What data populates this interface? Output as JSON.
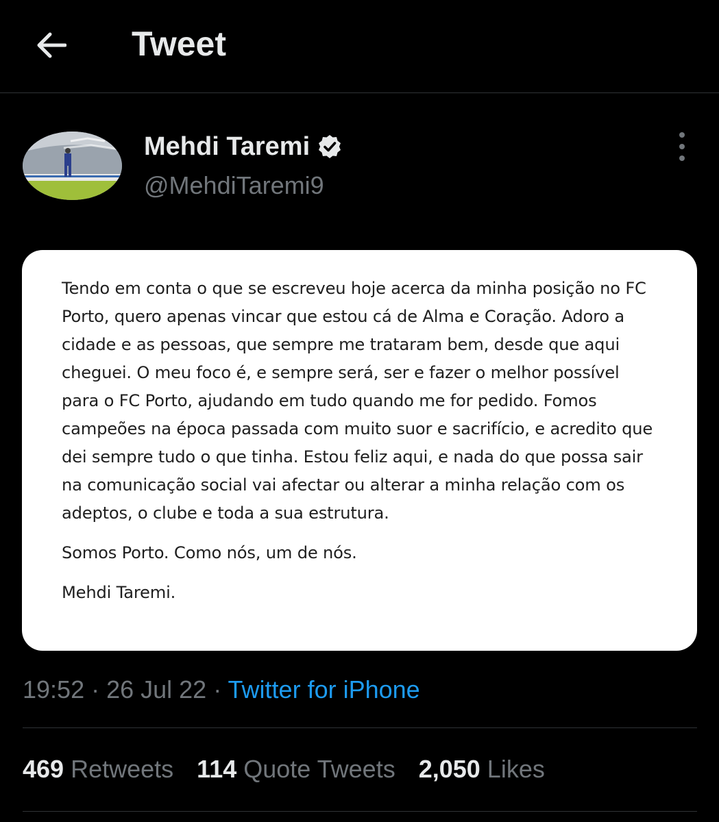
{
  "header": {
    "title": "Tweet",
    "back_icon": "arrow-left-icon"
  },
  "author": {
    "display_name": "Mehdi Taremi",
    "handle": "@MehdiTaremi9",
    "verified": true
  },
  "statement": {
    "paragraph1": "Tendo em conta o que se escreveu hoje acerca da minha posição no FC Porto, quero apenas vincar que estou cá de Alma e Coração. Adoro a cidade e as pessoas, que sempre me trataram bem, desde que aqui cheguei. O meu foco é, e sempre será, ser e fazer o melhor possível para o FC Porto, ajudando em tudo quando me for pedido. Fomos campeões na época passada com muito suor e sacrifício, e acredito que dei sempre tudo o que tinha. Estou feliz aqui, e nada do que possa sair na comunicação social vai afectar ou alterar a minha relação com os adeptos, o clube  e toda a sua estrutura.",
    "paragraph2": "Somos Porto. Como nós, um de nós.",
    "signature": "Mehdi Taremi."
  },
  "meta": {
    "time": "19:52",
    "separator1": " · ",
    "date": "26 Jul 22",
    "separator2": " · ",
    "source": "Twitter for iPhone"
  },
  "stats": {
    "retweets_count": "469",
    "retweets_label": "Retweets",
    "quotes_count": "114",
    "quotes_label": "Quote Tweets",
    "likes_count": "2,050",
    "likes_label": "Likes"
  },
  "colors": {
    "background": "#000000",
    "primary_text": "#e7e9ea",
    "secondary_text": "#71767b",
    "link": "#1d9bf0",
    "divider": "#2f3336"
  }
}
